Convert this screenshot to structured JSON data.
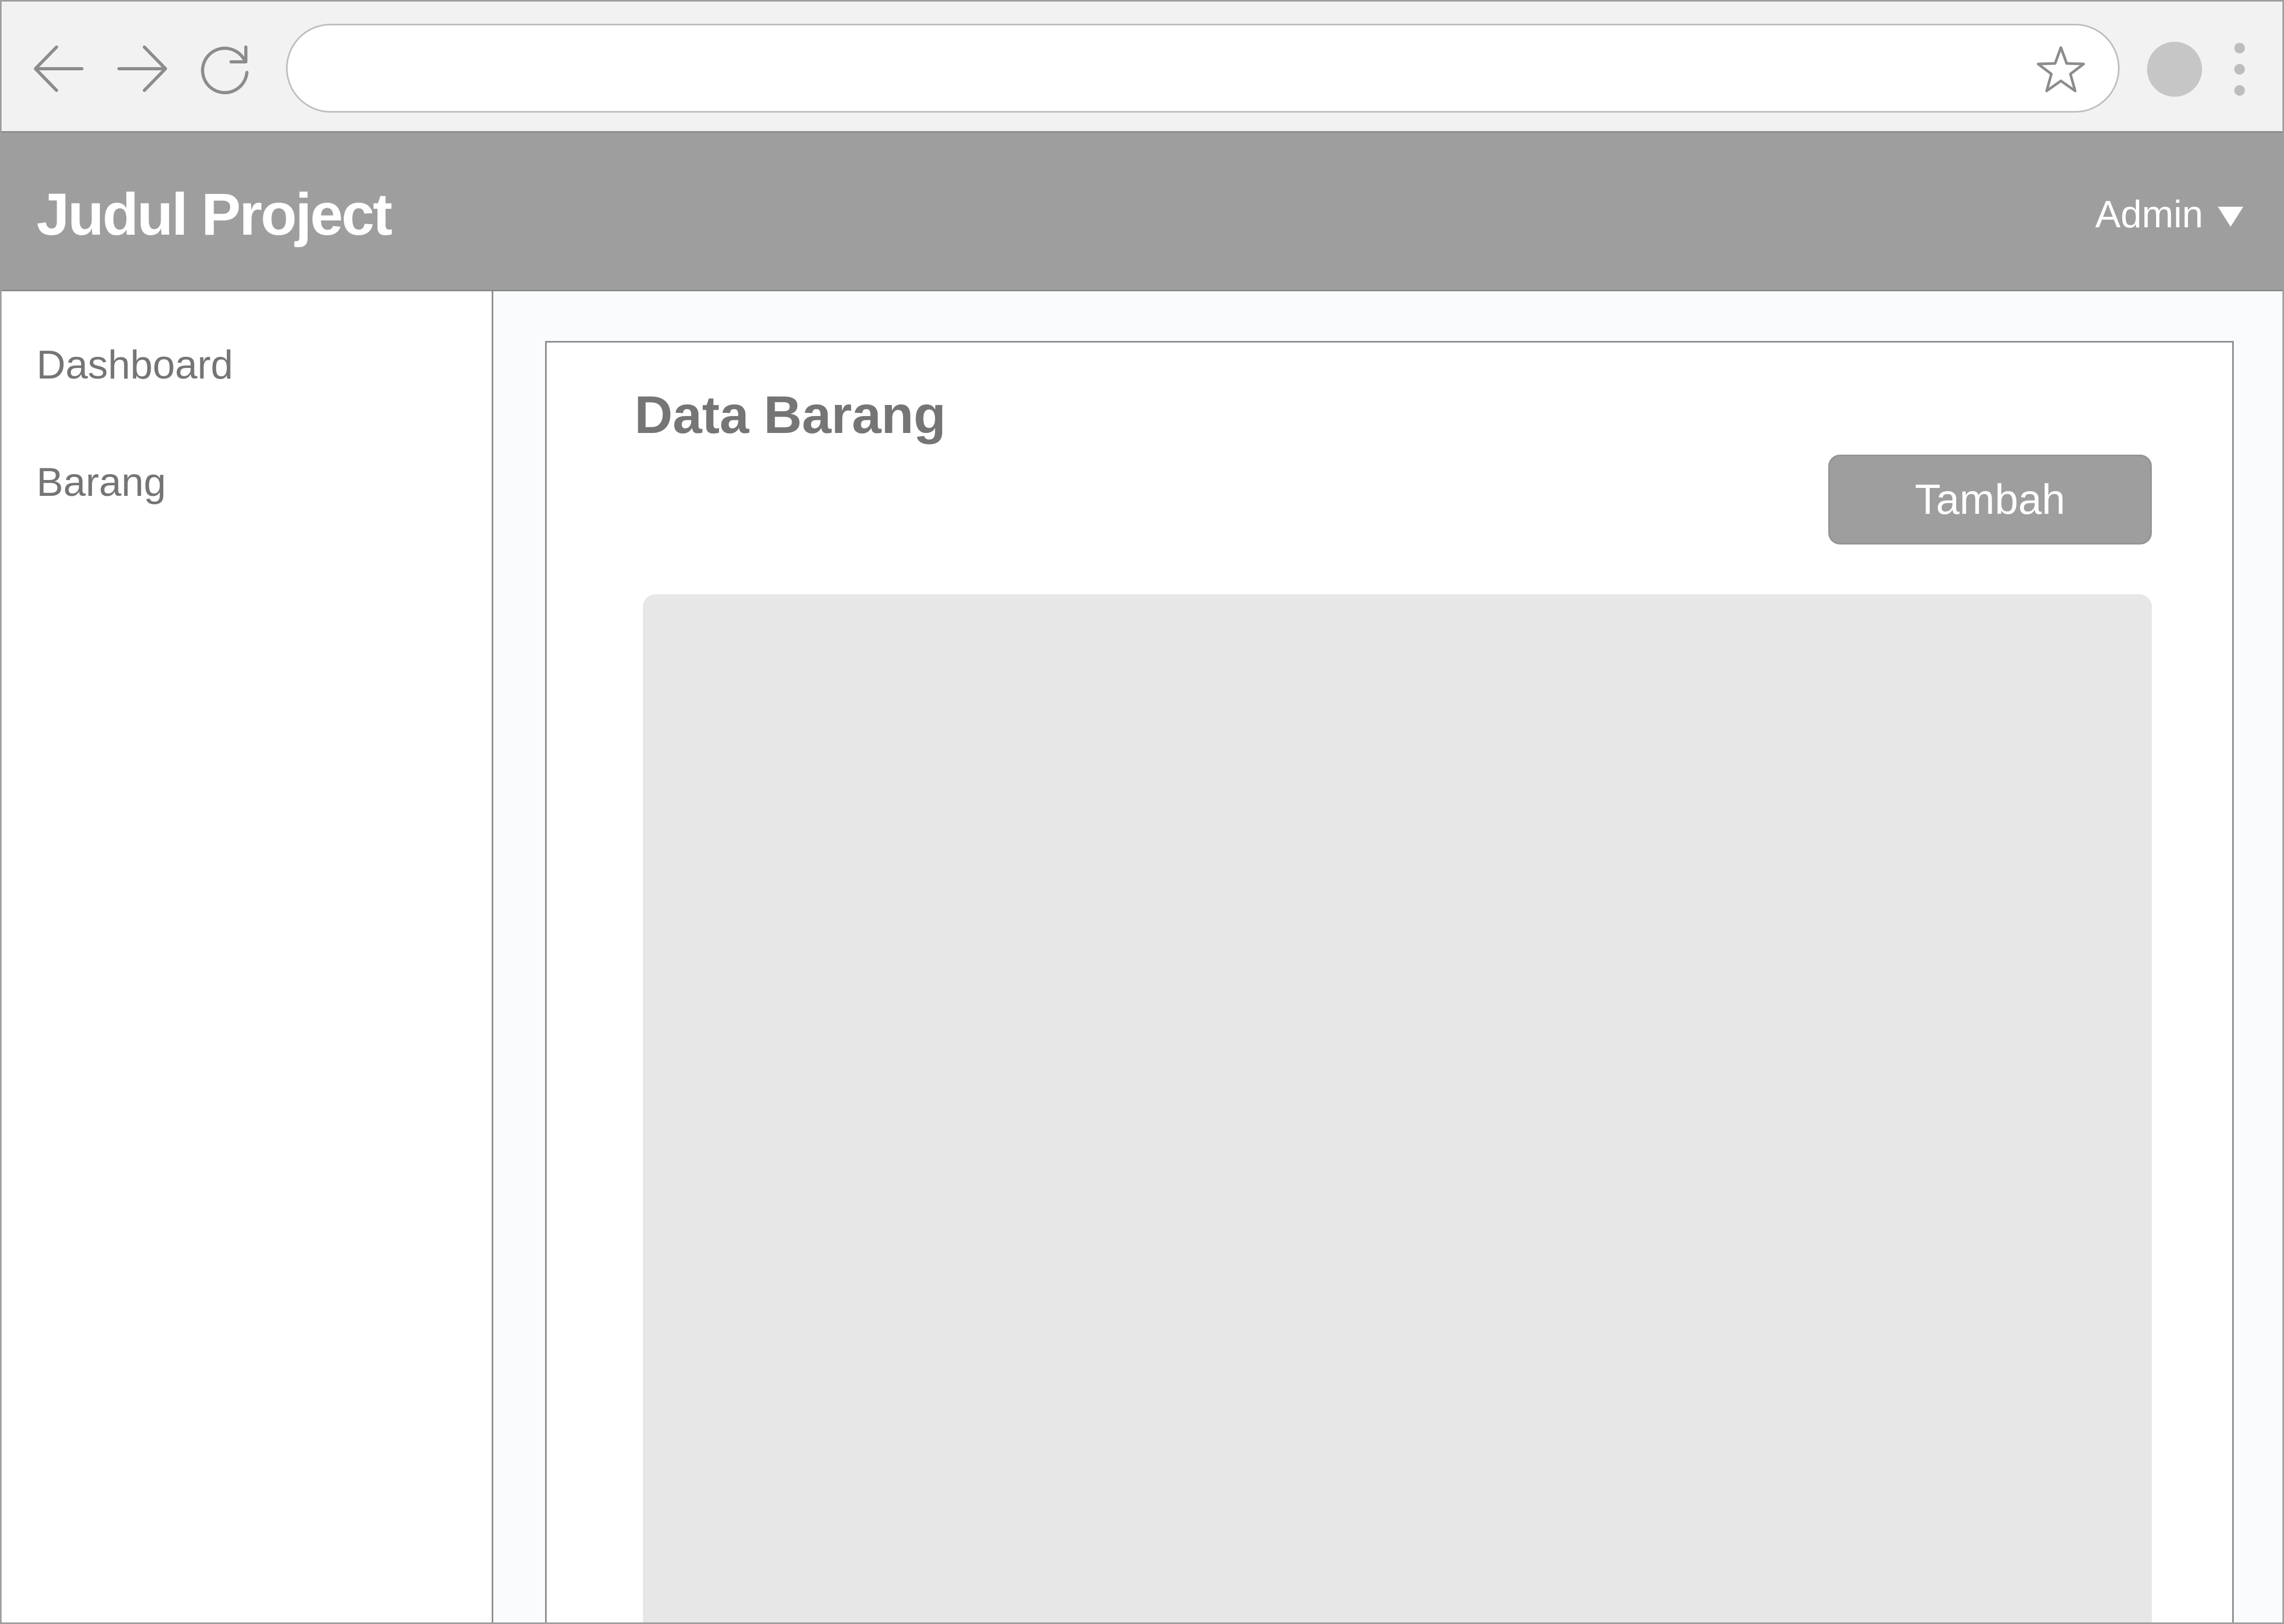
{
  "browser": {
    "url": "",
    "icons": {
      "back": "arrow-left-icon",
      "forward": "arrow-right-icon",
      "reload": "reload-icon",
      "bookmark": "star-icon",
      "profile": "profile-avatar",
      "menu": "kebab-menu-icon"
    }
  },
  "header": {
    "title": "Judul Project",
    "user": "Admin"
  },
  "sidebar": {
    "items": [
      {
        "label": "Dashboard"
      },
      {
        "label": "Barang"
      }
    ]
  },
  "main": {
    "title": "Data Barang",
    "add_button": "Tambah"
  },
  "colors": {
    "header_bg": "#9e9e9e",
    "button_bg": "#9e9e9e",
    "text_muted": "#757575",
    "placeholder_bg": "#e7e7e7"
  }
}
